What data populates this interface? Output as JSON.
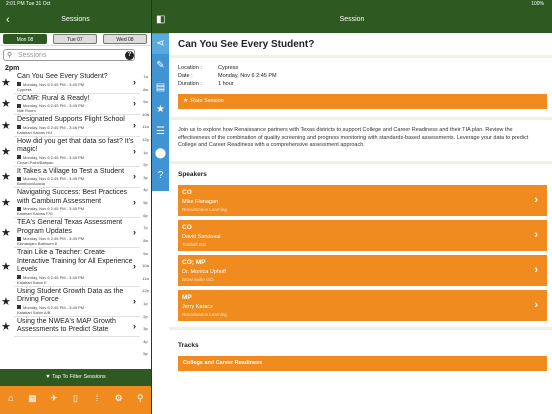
{
  "status": {
    "time": "2:01 PM  Tue 31 Oct",
    "battery": "100%"
  },
  "left_header": {
    "back": "‹",
    "title": "Sessions"
  },
  "right_header": {
    "title": "Session"
  },
  "day_tabs": [
    {
      "label": "Mon 08",
      "active": true
    },
    {
      "label": "Tue 07",
      "active": false
    },
    {
      "label": "Wed 08",
      "active": false
    }
  ],
  "search": {
    "placeholder": "Sessions"
  },
  "time_header": "2pm",
  "sessions": [
    {
      "title": "Can You See Every Student?",
      "time": "Monday, Nov 6 2:45 PM - 3:45 PM",
      "room": "Cypress",
      "lines": 1
    },
    {
      "title": "CCMR: Rural & Ready!",
      "time": "Monday, Nov 6 2:45 PM - 3:45 PM",
      "room": "Nile Room",
      "lines": 1
    },
    {
      "title": "Designated Supports Flight School",
      "time": "Monday, Nov 6 2:45 PM - 3:45 PM",
      "room": "Kalahari Salons H/J",
      "lines": 1
    },
    {
      "title": "How did you get that data so fast? It's magic!",
      "time": "Monday, Nov 6 2:45 PM - 3:45 PM",
      "room": "Crown Palm/Banyan",
      "lines": 2
    },
    {
      "title": "It Takes a Village to Test a Student",
      "time": "Monday, Nov 6 2:45 PM - 3:45 PM",
      "room": "Bamboo/Acacia",
      "lines": 1
    },
    {
      "title": "Navigating Success: Best Practices with Cambium Assessment",
      "time": "Monday, Nov 6 2:45 PM - 3:45 PM",
      "room": "Kalahari Salons F/G",
      "lines": 2
    },
    {
      "title": "TEA's General Texas Assessment Program Updates",
      "time": "Monday, Nov 6 2:45 PM - 3:45 PM",
      "room": "Kilimanjaro Ballroom 8",
      "lines": 2
    },
    {
      "title": "Train Like a Teacher: Create Interactive Training for All Experience Levels",
      "time": "Monday, Nov 6 2:45 PM - 3:45 PM",
      "room": "Kalahari Salon E",
      "lines": 3
    },
    {
      "title": "Using Student Growth Data as the Driving Force",
      "time": "Monday, Nov 6 2:45 PM - 3:45 PM",
      "room": "Kalahari Salon A/B",
      "lines": 2
    },
    {
      "title": "Using the NWEA's MAP Growth Assessments to Predict State",
      "time": "",
      "room": "",
      "lines": 2
    }
  ],
  "index_labels": [
    "7a",
    "8a",
    "9a",
    "10a",
    "11a",
    "12p",
    "1p",
    "2p",
    "3p",
    "4p",
    "5p",
    "6p",
    "7p",
    "8a",
    "9a",
    "10a",
    "11a",
    "12p",
    "1p",
    "2p",
    "3p",
    "4p",
    "5p"
  ],
  "filter": {
    "label": "Tap To Filter Sessions"
  },
  "nav_icons": [
    "home-icon",
    "bus-icon",
    "plane-icon",
    "phone-icon",
    "grid-icon",
    "gear-icon",
    "search-icon"
  ],
  "rail_icons": [
    "share-icon",
    "pencil-icon",
    "clipboard-icon",
    "star-icon",
    "chat-icon",
    "map-pin-icon",
    "help-icon"
  ],
  "detail": {
    "title": "Can You See Every Student?",
    "location_label": "Location :",
    "location": "Cypress",
    "date_label": "Date :",
    "date": "Monday, Nov 6 2:45 PM",
    "duration_label": "Duration :",
    "duration": "1 hour",
    "rate_label": "Rate Session",
    "description": "Join us to explore how Renaissance partners with Texas districts to support College and Career Readiness and their TIA plan. Review the effectiveness of the combination of quality screening and progress monitoring with standards-based assessments. Leverage your data to predict College and Career Readiness with a comprehensive assessment approach.",
    "speakers_label": "Speakers",
    "speakers": [
      {
        "role": "CO",
        "name": "Mike Flanagan",
        "org": "Renaissance Learning"
      },
      {
        "role": "CO",
        "name": "David Sandoval",
        "org": "Tomball ISD"
      },
      {
        "role": "CO; MP",
        "name": "Dr. Monica Uphoff",
        "org": "Brownsville ISD"
      },
      {
        "role": "MP",
        "name": "Jerry Karacz",
        "org": "Renaissance Learning"
      }
    ],
    "tracks_label": "Tracks",
    "track": "College and Career Readiness"
  },
  "colors": {
    "header_green": "#2e5a22",
    "accent_orange": "#f08c1f",
    "rail_blue": "#3f94d1"
  }
}
